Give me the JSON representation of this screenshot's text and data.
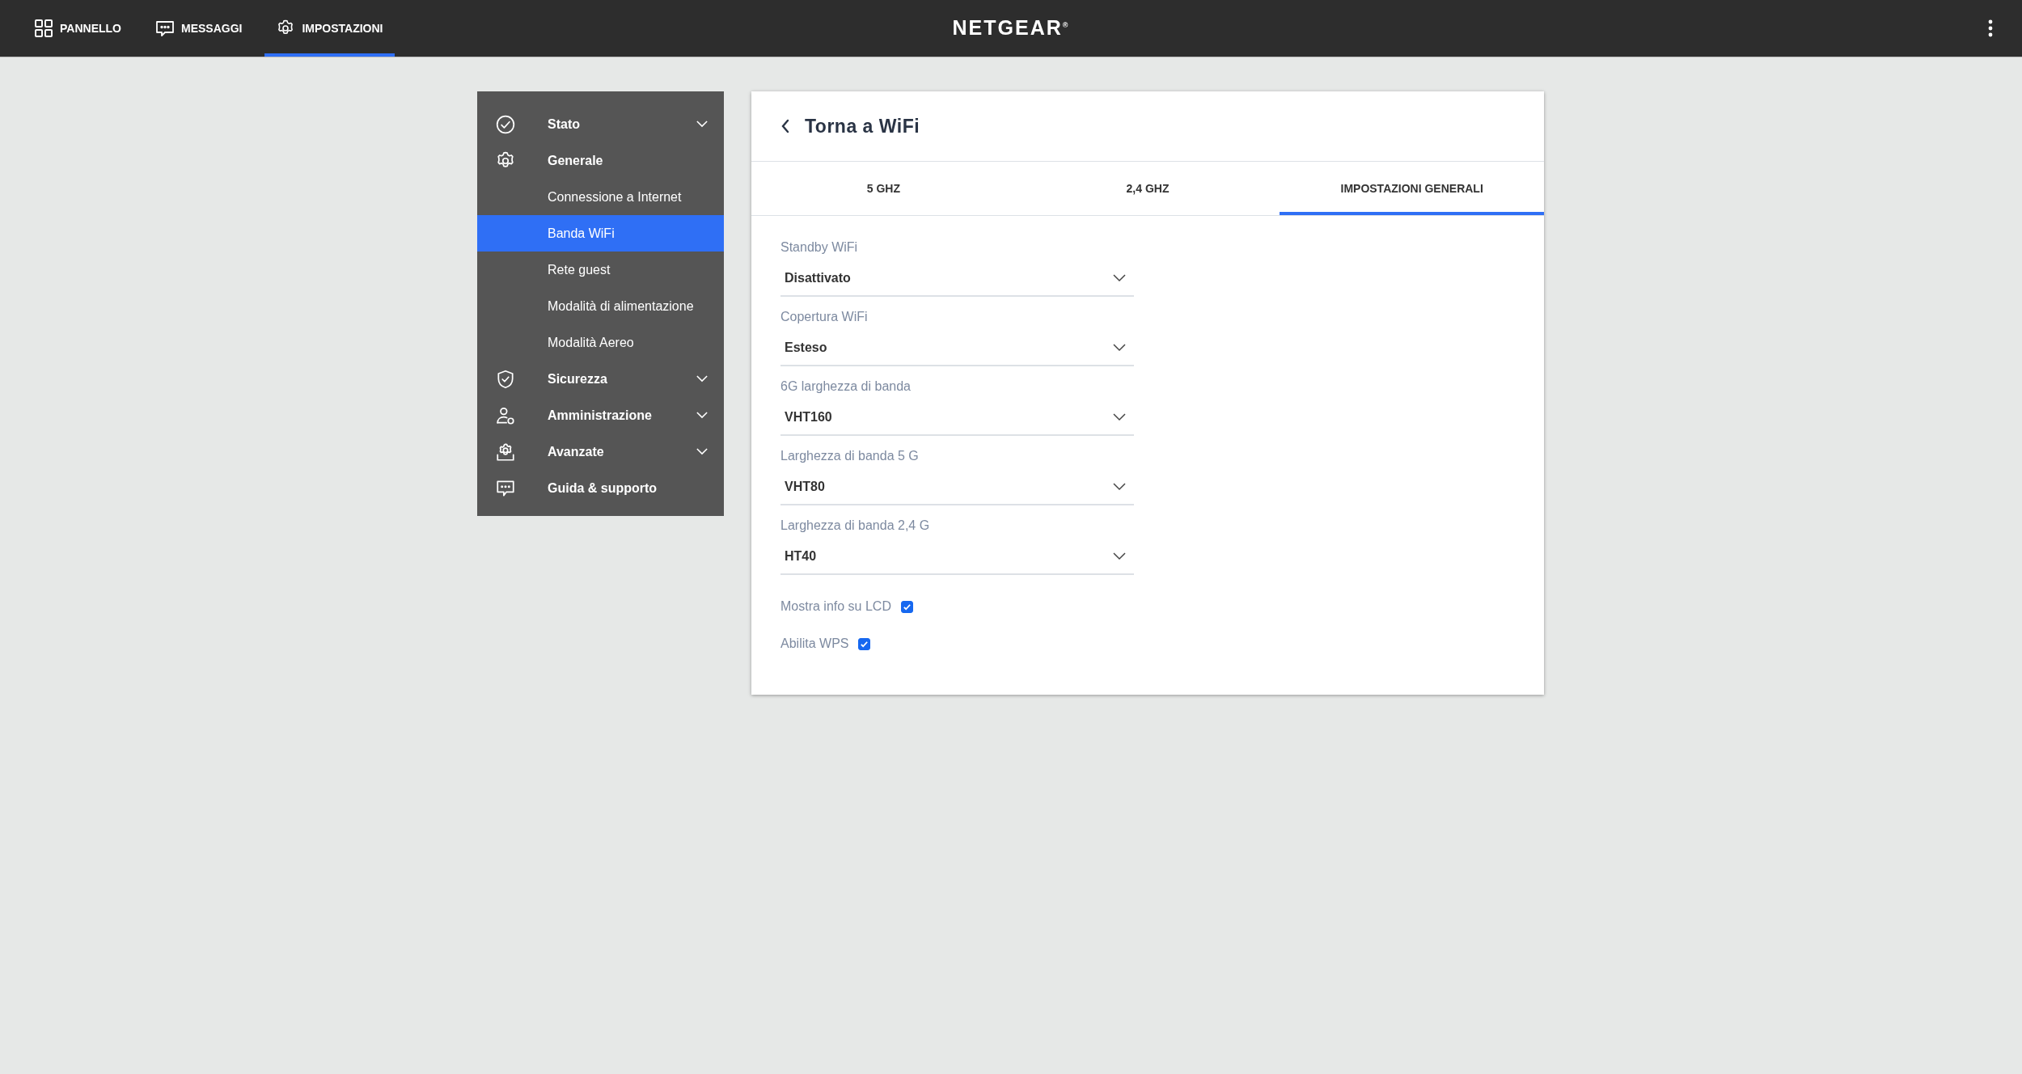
{
  "top_nav": {
    "tabs": [
      {
        "label": "PANNELLO",
        "selected": false
      },
      {
        "label": "MESSAGGI",
        "selected": false
      },
      {
        "label": "IMPOSTAZIONI",
        "selected": true
      }
    ],
    "logo": "NETGEAR$^{®}$"
  },
  "sidebar": {
    "items": [
      {
        "label": "Stato",
        "expanded": false,
        "selected": false
      },
      {
        "label": "Generale",
        "expanded": true,
        "selected": false,
        "children": [
          {
            "label": "Connessione a Internet",
            "selected": false
          },
          {
            "label": "Banda WiFi",
            "selected": true
          },
          {
            "label": "Rete guest",
            "selected": false
          },
          {
            "label": "Modalità di alimentazione",
            "selected": false
          },
          {
            "label": "Modalità Aereo",
            "selected": false
          }
        ]
      },
      {
        "label": "Sicurezza",
        "expanded": false,
        "selected": false
      },
      {
        "label": "Amministrazione",
        "expanded": false,
        "selected": false
      },
      {
        "label": "Avanzate",
        "expanded": false,
        "selected": false
      },
      {
        "label": "Guida & supporto",
        "selected": false
      }
    ]
  },
  "panel": {
    "back_label": "Torna a WiFi",
    "tabs": [
      {
        "label": "5 GHZ",
        "selected": false
      },
      {
        "label": "2,4 GHZ",
        "selected": false
      },
      {
        "label": "IMPOSTAZIONI GENERALI",
        "selected": true
      }
    ],
    "fields": [
      {
        "label": "Standby WiFi",
        "value": "Disattivato"
      },
      {
        "label": "Copertura WiFi",
        "value": "Esteso"
      },
      {
        "label": "6G larghezza di banda",
        "value": "VHT160"
      },
      {
        "label": "Larghezza di banda 5 G",
        "value": "VHT80"
      },
      {
        "label": "Larghezza di banda 2,4 G",
        "value": "HT40"
      }
    ],
    "checkboxes": [
      {
        "label": "Mostra info su LCD",
        "checked": true
      },
      {
        "label": "Abilita WPS",
        "checked": true
      }
    ]
  }
}
